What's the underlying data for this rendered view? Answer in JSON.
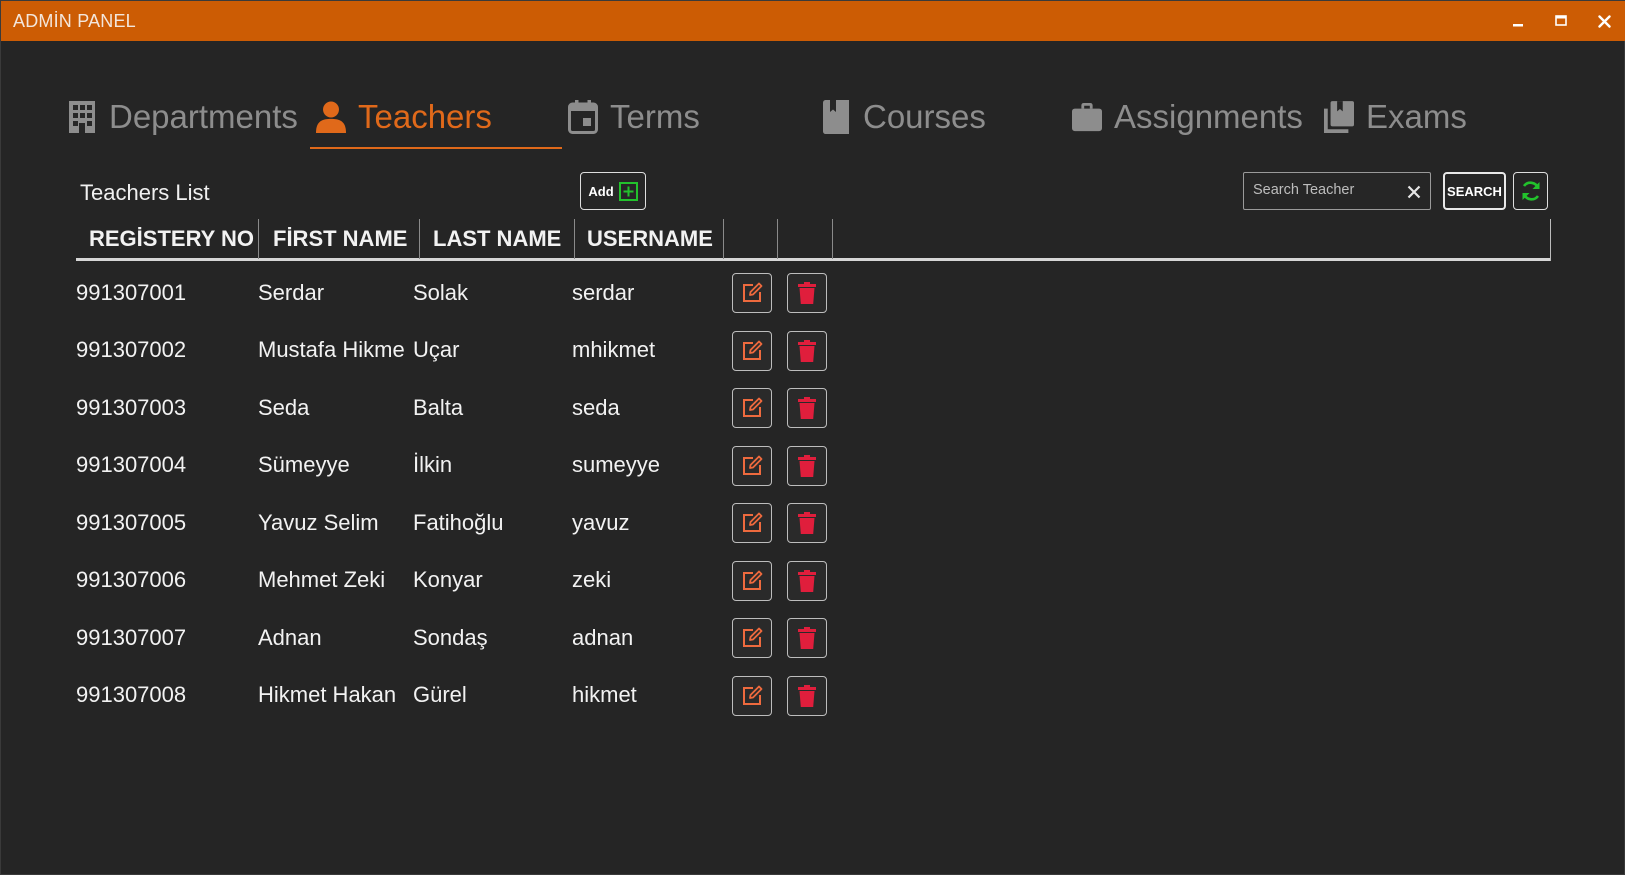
{
  "window": {
    "title": "ADMİN PANEL",
    "accent_color": "#cc5c04",
    "controls": [
      "minimize-icon",
      "maximize-icon",
      "close-icon"
    ]
  },
  "tabs": [
    {
      "label": "Departments",
      "icon": "building-icon",
      "active": false
    },
    {
      "label": "Teachers",
      "icon": "person-icon",
      "active": true
    },
    {
      "label": "Terms",
      "icon": "calendar-icon",
      "active": false
    },
    {
      "label": "Courses",
      "icon": "book-icon",
      "active": false
    },
    {
      "label": "Assignments",
      "icon": "briefcase-icon",
      "active": false
    },
    {
      "label": "Exams",
      "icon": "books-icon",
      "active": false
    }
  ],
  "toolbar": {
    "list_title": "Teachers List",
    "add_label": "Add",
    "search_placeholder": "Search Teacher",
    "search_value": "",
    "search_label": "SEARCH"
  },
  "table": {
    "columns": [
      "REGİSTERY NO",
      "FİRST NAME",
      "LAST NAME",
      "USERNAME",
      "",
      ""
    ],
    "rows": [
      {
        "registery_no": "991307001",
        "first_name": "Serdar",
        "last_name": "Solak",
        "username": "serdar"
      },
      {
        "registery_no": "991307002",
        "first_name": "Mustafa Hikme",
        "last_name": "Uçar",
        "username": "mhikmet"
      },
      {
        "registery_no": "991307003",
        "first_name": "Seda",
        "last_name": "Balta",
        "username": "seda"
      },
      {
        "registery_no": "991307004",
        "first_name": "Sümeyye",
        "last_name": "İlkin",
        "username": "sumeyye"
      },
      {
        "registery_no": "991307005",
        "first_name": "Yavuz Selim",
        "last_name": "Fatihoğlu",
        "username": "yavuz"
      },
      {
        "registery_no": "991307006",
        "first_name": "Mehmet Zeki",
        "last_name": "Konyar",
        "username": "zeki"
      },
      {
        "registery_no": "991307007",
        "first_name": "Adnan",
        "last_name": "Sondaş",
        "username": "adnan"
      },
      {
        "registery_no": "991307008",
        "first_name": "Hikmet Hakan",
        "last_name": "Gürel",
        "username": "hikmet"
      }
    ],
    "row_actions": [
      "edit-icon",
      "trash-icon"
    ]
  },
  "colors": {
    "background": "#252525",
    "accent_orange": "#e0691a",
    "inactive_tab": "#8d8d8d",
    "edit_icon": "#ee6a3e",
    "delete_icon": "#e01e3c",
    "add_icon": "#22c22c",
    "refresh_icon": "#22c22c"
  }
}
